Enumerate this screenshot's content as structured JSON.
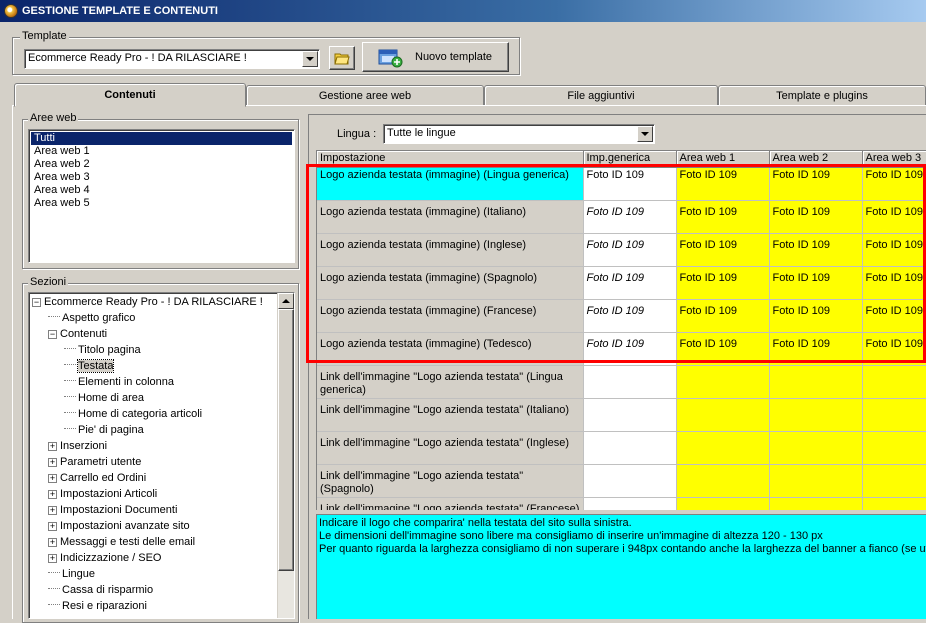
{
  "window": {
    "title": "GESTIONE TEMPLATE E CONTENUTI"
  },
  "template": {
    "group_label": "Template",
    "selected": "Ecommerce Ready Pro - ! DA RILASCIARE !",
    "new_button": "Nuovo template"
  },
  "tabs": [
    {
      "label": "Contenuti",
      "active": true
    },
    {
      "label": "Gestione aree web",
      "active": false
    },
    {
      "label": "File aggiuntivi",
      "active": false
    },
    {
      "label": "Template e plugins",
      "active": false
    }
  ],
  "aree_web": {
    "group_label": "Aree web",
    "items": [
      "Tutti",
      "Area web 1",
      "Area web 2",
      "Area web 3",
      "Area web 4",
      "Area web 5"
    ],
    "selected_index": 0
  },
  "sezioni": {
    "group_label": "Sezioni",
    "tree": [
      {
        "label": "Ecommerce Ready Pro - ! DA RILASCIARE !",
        "level": 0,
        "expander": "−"
      },
      {
        "label": "Aspetto grafico",
        "level": 1,
        "expander": ""
      },
      {
        "label": "Contenuti",
        "level": 1,
        "expander": "−"
      },
      {
        "label": "Titolo pagina",
        "level": 2,
        "expander": ""
      },
      {
        "label": "Testata",
        "level": 2,
        "expander": "",
        "selected": true
      },
      {
        "label": "Elementi in colonna",
        "level": 2,
        "expander": ""
      },
      {
        "label": "Home di area",
        "level": 2,
        "expander": ""
      },
      {
        "label": "Home di categoria articoli",
        "level": 2,
        "expander": ""
      },
      {
        "label": "Pie' di pagina",
        "level": 2,
        "expander": ""
      },
      {
        "label": "Inserzioni",
        "level": 1,
        "expander": "+"
      },
      {
        "label": "Parametri utente",
        "level": 1,
        "expander": "+"
      },
      {
        "label": "Carrello ed Ordini",
        "level": 1,
        "expander": "+"
      },
      {
        "label": "Impostazioni Articoli",
        "level": 1,
        "expander": "+"
      },
      {
        "label": "Impostazioni Documenti",
        "level": 1,
        "expander": "+"
      },
      {
        "label": "Impostazioni avanzate sito",
        "level": 1,
        "expander": "+"
      },
      {
        "label": "Messaggi e testi delle email",
        "level": 1,
        "expander": "+"
      },
      {
        "label": "Indicizzazione / SEO",
        "level": 1,
        "expander": "+"
      },
      {
        "label": "Lingue",
        "level": 1,
        "expander": ""
      },
      {
        "label": "Cassa di risparmio",
        "level": 1,
        "expander": ""
      },
      {
        "label": "Resi e riparazioni",
        "level": 1,
        "expander": ""
      }
    ]
  },
  "lingua": {
    "label": "Lingua :",
    "selected": "Tutte le lingue"
  },
  "grid": {
    "columns": [
      "Impostazione",
      "Imp.generica",
      "Area web 1",
      "Area web 2",
      "Area web 3"
    ],
    "rows": [
      {
        "setting": "Logo azienda testata (immagine) (Lingua generica)",
        "generic": "Foto ID 109",
        "a1": "Foto ID 109",
        "a2": "Foto ID 109",
        "a3": "Foto ID 109"
      },
      {
        "setting": "Logo azienda testata (immagine) (Italiano)",
        "generic": "Foto ID 109",
        "a1": "Foto ID 109",
        "a2": "Foto ID 109",
        "a3": "Foto ID 109"
      },
      {
        "setting": "Logo azienda testata (immagine) (Inglese)",
        "generic": "Foto ID 109",
        "a1": "Foto ID 109",
        "a2": "Foto ID 109",
        "a3": "Foto ID 109"
      },
      {
        "setting": "Logo azienda testata (immagine) (Spagnolo)",
        "generic": "Foto ID 109",
        "a1": "Foto ID 109",
        "a2": "Foto ID 109",
        "a3": "Foto ID 109"
      },
      {
        "setting": "Logo azienda testata (immagine) (Francese)",
        "generic": "Foto ID 109",
        "a1": "Foto ID 109",
        "a2": "Foto ID 109",
        "a3": "Foto ID 109"
      },
      {
        "setting": "Logo azienda testata (immagine) (Tedesco)",
        "generic": "Foto ID 109",
        "a1": "Foto ID 109",
        "a2": "Foto ID 109",
        "a3": "Foto ID 109"
      },
      {
        "setting": "Link dell'immagine \"Logo azienda testata\" (Lingua generica)",
        "generic": "",
        "a1": "",
        "a2": "",
        "a3": ""
      },
      {
        "setting": "Link dell'immagine \"Logo azienda testata\" (Italiano)",
        "generic": "",
        "a1": "",
        "a2": "",
        "a3": ""
      },
      {
        "setting": "Link dell'immagine \"Logo azienda testata\" (Inglese)",
        "generic": "",
        "a1": "",
        "a2": "",
        "a3": ""
      },
      {
        "setting": "Link dell'immagine \"Logo azienda testata\" (Spagnolo)",
        "generic": "",
        "a1": "",
        "a2": "",
        "a3": ""
      },
      {
        "setting": "Link dell'immagine \"Logo azienda testata\" (Francese)",
        "generic": "",
        "a1": "",
        "a2": "",
        "a3": ""
      }
    ]
  },
  "description": [
    "Indicare il logo che comparira' nella testata del sito sulla sinistra.",
    "Le dimensioni dell'immagine sono libere ma consigliamo di inserire un'immagine di altezza 120 - 130 px",
    "Per quanto riguarda la larghezza consigliamo di non superare i 948px contando anche la larghezza del banner a fianco (se util"
  ],
  "colors": {
    "highlight_border": "#ff0000",
    "area_cell": "#ffff00",
    "selected_cell": "#00ffff",
    "description_bg": "#00ffff"
  }
}
